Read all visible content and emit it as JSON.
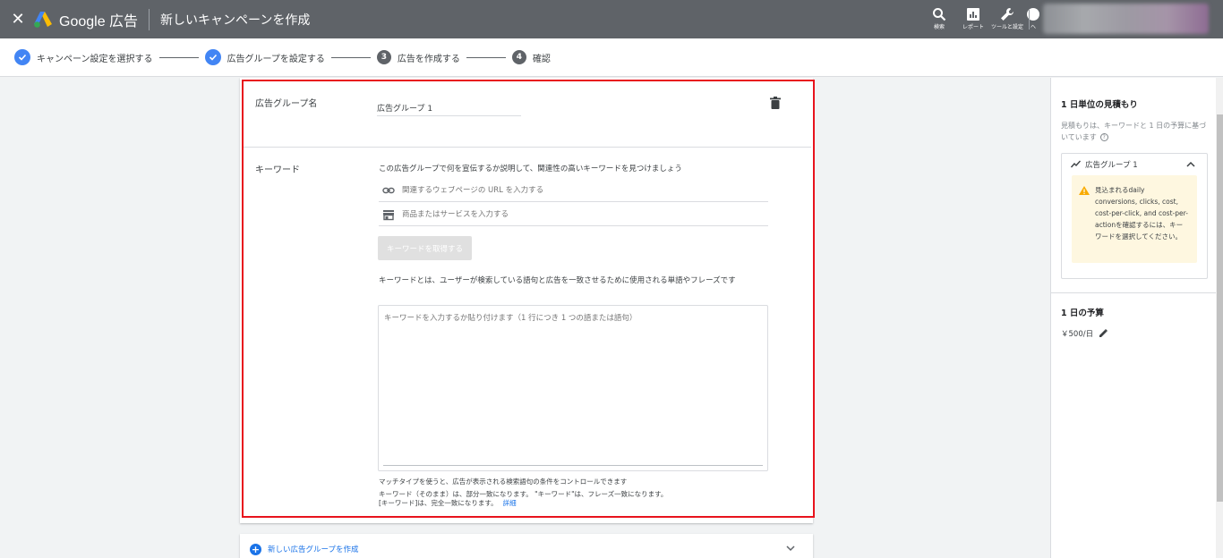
{
  "app": {
    "brand": "Google 広告",
    "page_title": "新しいキャンペーンを作成"
  },
  "topbar": {
    "actions": [
      {
        "label": "検索",
        "icon": "search-icon"
      },
      {
        "label": "レポート",
        "icon": "report-icon"
      },
      {
        "label": "ツールと設定",
        "icon": "wrench-icon"
      },
      {
        "label": "ヘ",
        "icon": "help-icon"
      }
    ]
  },
  "stepper": {
    "steps": [
      {
        "num": "1",
        "label": "キャンペーン設定を選択する",
        "state": "done"
      },
      {
        "num": "2",
        "label": "広告グループを設定する",
        "state": "done"
      },
      {
        "num": "3",
        "label": "広告を作成する",
        "state": "todo"
      },
      {
        "num": "4",
        "label": "確認",
        "state": "todo"
      }
    ]
  },
  "ad_group": {
    "name_label": "広告グループ名",
    "name_value": "広告グループ 1",
    "keywords_label": "キーワード",
    "keywords_description": "この広告グループで何を宣伝するか説明して、関連性の高いキーワードを見つけましょう",
    "url_placeholder": "関連するウェブページの URL を入力する",
    "product_placeholder": "商品またはサービスを入力する",
    "get_keywords_button": "キーワードを取得する",
    "keywords_explanation": "キーワードとは、ユーザーが検索している語句と広告を一致させるために使用される単語やフレーズです",
    "keywords_textarea_placeholder": "キーワードを入力するか貼り付けます（1 行につき 1 つの語または語句）",
    "match_type_note": "マッチタイプを使うと、広告が表示される検索語句の条件をコントロールできます",
    "match_type_line1": "キーワード（そのまま）は、部分一致になります。 \"キーワード\"は、フレーズ一致になります。",
    "match_type_line2": "[キーワード]は、完全一致になります。",
    "details_link": "詳細"
  },
  "new_ad_group": {
    "label": "新しい広告グループを作成"
  },
  "right_panel": {
    "estimate_title": "1 日単位の見積もり",
    "estimate_description": "見積もりは、キーワードと 1 日の予算に基づいています",
    "help_glyph": "?",
    "group_name": "広告グループ 1",
    "warning_text": "見込まれるdaily conversions, clicks, cost, cost-per-click, and cost-per-actionを確認するには、キーワードを選択してください。",
    "budget_title": "1 日の予算",
    "budget_value": "￥500/日"
  },
  "colors": {
    "topbar": "#5f6368",
    "accent": "#1a73e8",
    "step_done": "#4285f4",
    "highlight": "#e8131d",
    "warning_bg": "#fef7e0",
    "warning_icon": "#f9ab00"
  }
}
